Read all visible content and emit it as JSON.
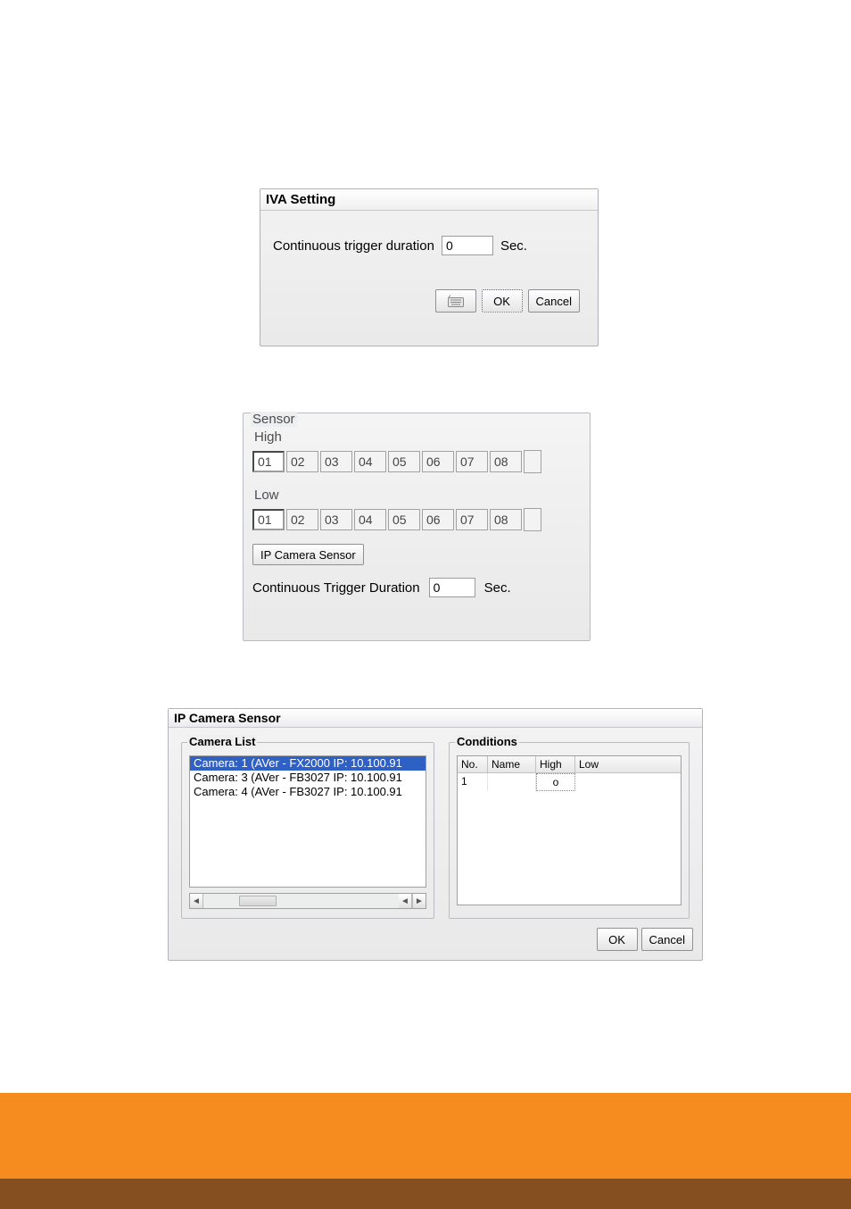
{
  "iva": {
    "title": "IVA Setting",
    "label": "Continuous trigger duration",
    "value": "0",
    "unit": "Sec.",
    "ok": "OK",
    "cancel": "Cancel"
  },
  "sensor": {
    "legend": "Sensor",
    "high_label": "High",
    "low_label": "Low",
    "cells_high": [
      "01",
      "02",
      "03",
      "04",
      "05",
      "06",
      "07",
      "08"
    ],
    "cells_low": [
      "01",
      "02",
      "03",
      "04",
      "05",
      "06",
      "07",
      "08"
    ],
    "ip_camera_button": "IP Camera Sensor",
    "ctd_label": "Continuous Trigger Duration",
    "ctd_value": "0",
    "ctd_unit": "Sec."
  },
  "ipcs": {
    "title": "IP Camera Sensor",
    "camera_list_legend": "Camera List",
    "cameras": [
      {
        "label": "Camera: 1 (AVer - FX2000 IP: 10.100.91",
        "selected": true
      },
      {
        "label": "Camera: 3 (AVer - FB3027 IP: 10.100.91",
        "selected": false
      },
      {
        "label": "Camera: 4 (AVer - FB3027 IP: 10.100.91",
        "selected": false
      }
    ],
    "conditions_legend": "Conditions",
    "cond_headers": {
      "no": "No.",
      "name": "Name",
      "high": "High",
      "low": "Low"
    },
    "cond_rows": [
      {
        "no": "1",
        "name": "",
        "high": "o",
        "low": ""
      }
    ],
    "ok": "OK",
    "cancel": "Cancel"
  }
}
